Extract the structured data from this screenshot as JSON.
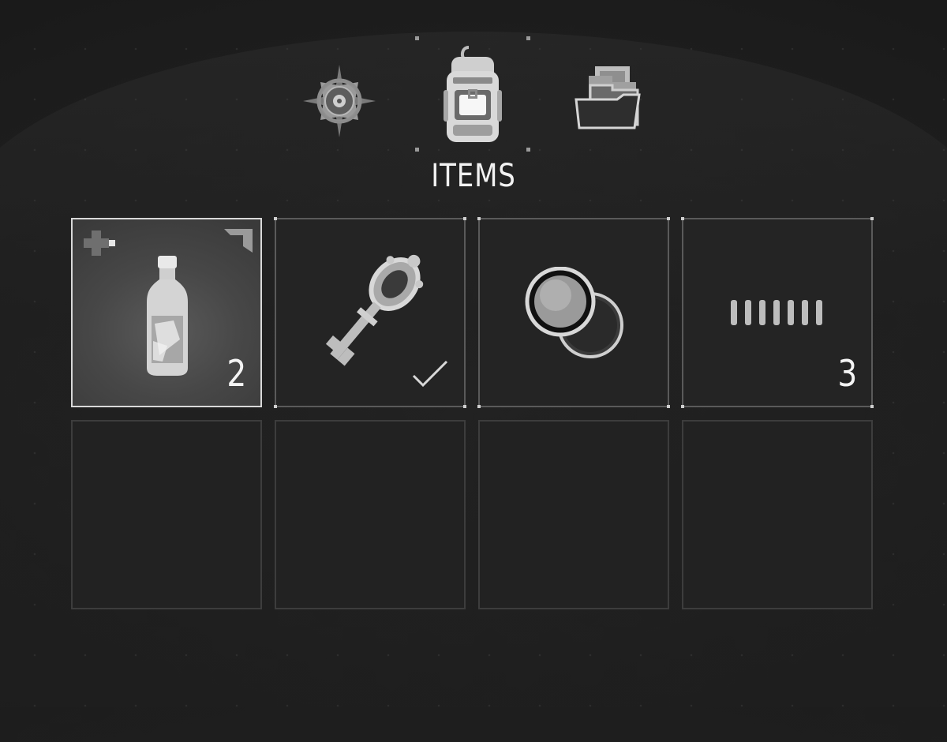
{
  "header": {
    "tabs": [
      {
        "id": "map",
        "icon": "compass-icon"
      },
      {
        "id": "items",
        "icon": "backpack-icon",
        "active": true
      },
      {
        "id": "files",
        "icon": "folder-icon"
      }
    ],
    "active_title": "ITEMS"
  },
  "inventory": {
    "slots": [
      {
        "item": "bottle",
        "icon": "healing-bottle-icon",
        "quantity": "2",
        "selected": true,
        "badges": [
          "health-cross-icon",
          "corner-bracket-icon"
        ]
      },
      {
        "item": "key",
        "icon": "ornate-key-icon",
        "equipped_check": true
      },
      {
        "item": "lens",
        "icon": "round-lens-icon"
      },
      {
        "item": "bullets",
        "icon": "ammo-rounds-icon",
        "quantity": "3"
      },
      {
        "item": null
      },
      {
        "item": null
      },
      {
        "item": null
      },
      {
        "item": null
      }
    ]
  },
  "colors": {
    "background": "#1d1d1d",
    "selected_border": "#d8d8d8",
    "slot_border": "#3d3d3d",
    "text": "#f2f2f2"
  }
}
